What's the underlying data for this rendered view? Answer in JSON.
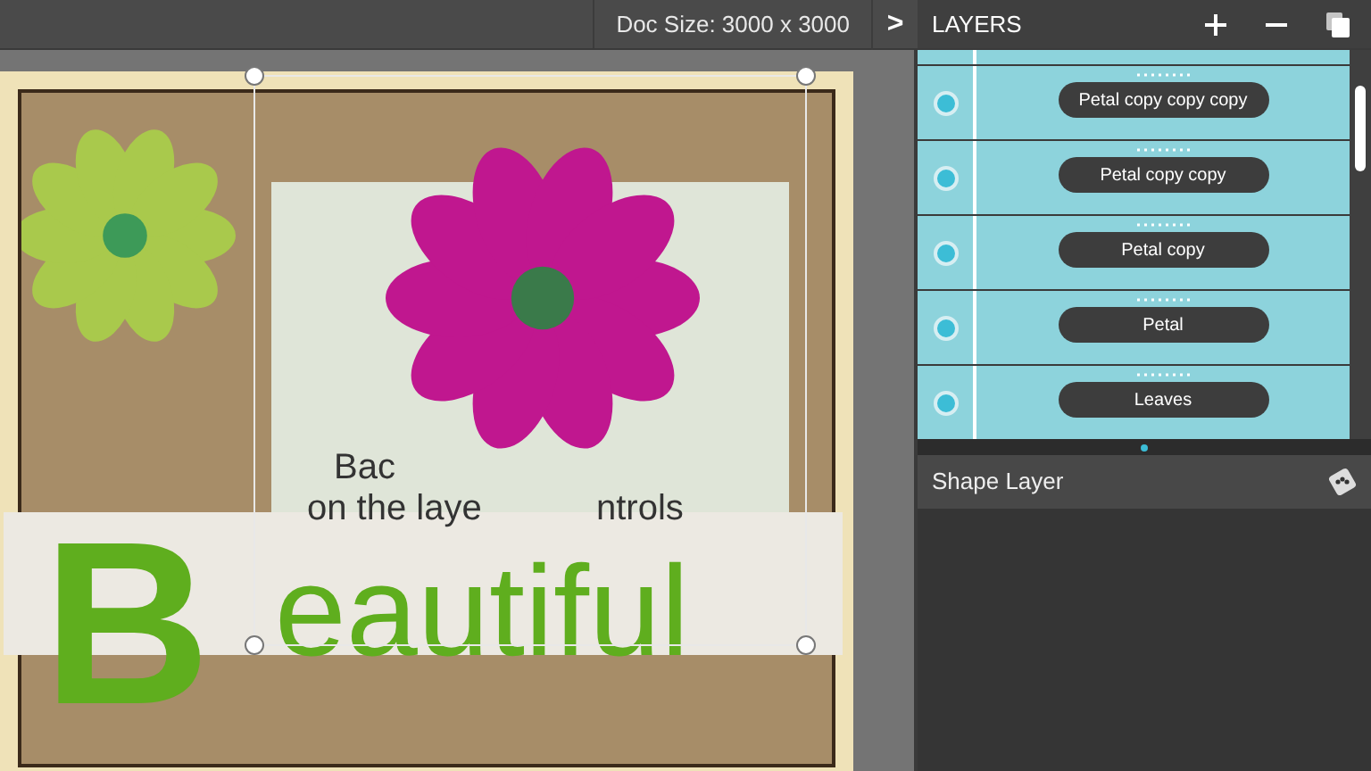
{
  "toolbar": {
    "doc_size": "Doc Size: 3000 x 3000",
    "expand": ">"
  },
  "canvas": {
    "title_letter": "B",
    "title_rest": "eautiful",
    "fragments": [
      "Bac",
      "on the laye",
      "ntrols"
    ]
  },
  "layers_panel": {
    "title": "LAYERS",
    "layers": [
      {
        "name": "Petal copy copy copy",
        "visible": true
      },
      {
        "name": "Petal copy copy",
        "visible": true
      },
      {
        "name": "Petal copy",
        "visible": true
      },
      {
        "name": "Petal",
        "visible": true
      },
      {
        "name": "Leaves",
        "visible": true
      }
    ]
  },
  "properties": {
    "title": "Shape Layer"
  }
}
